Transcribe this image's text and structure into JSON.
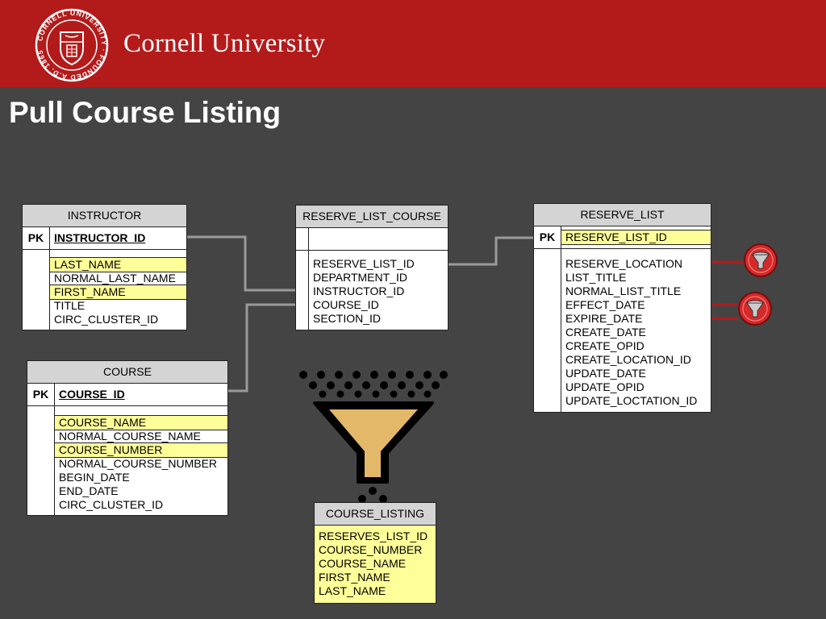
{
  "header": {
    "brand": "Cornell University",
    "seal_text": "CORNELL UNIVERSITY · FOUNDED A.D. 1865"
  },
  "slide": {
    "title": "Pull Course Listing"
  },
  "colors": {
    "header": "#b31b1b",
    "background": "#444444",
    "highlight": "#ffff99",
    "arrow": "#b31b1b",
    "connector": "#9a9a9a",
    "funnel": "#e3b868"
  },
  "tables": {
    "instructor": {
      "name": "INSTRUCTOR",
      "pk_label": "PK",
      "pk_field": "INSTRUCTOR_ID",
      "fields": [
        {
          "name": "LAST_NAME",
          "highlighted": true
        },
        {
          "name": "NORMAL_LAST_NAME",
          "highlighted": false
        },
        {
          "name": "FIRST_NAME",
          "highlighted": true
        },
        {
          "name": "TITLE",
          "highlighted": false
        },
        {
          "name": "CIRC_CLUSTER_ID",
          "highlighted": false
        }
      ]
    },
    "course": {
      "name": "COURSE",
      "pk_label": "PK",
      "pk_field": "COURSE_ID",
      "fields": [
        {
          "name": "COURSE_NAME",
          "highlighted": true
        },
        {
          "name": "NORMAL_COURSE_NAME",
          "highlighted": false
        },
        {
          "name": "COURSE_NUMBER",
          "highlighted": true
        },
        {
          "name": "NORMAL_COURSE_NUMBER",
          "highlighted": false
        },
        {
          "name": "BEGIN_DATE",
          "highlighted": false
        },
        {
          "name": "END_DATE",
          "highlighted": false
        },
        {
          "name": "CIRC_CLUSTER_ID",
          "highlighted": false
        }
      ]
    },
    "reserve_list_course": {
      "name": "RESERVE_LIST_COURSE",
      "fields": [
        "RESERVE_LIST_ID",
        "DEPARTMENT_ID",
        "INSTRUCTOR_ID",
        "COURSE_ID",
        "SECTION_ID"
      ]
    },
    "reserve_list": {
      "name": "RESERVE_LIST",
      "pk_label": "PK",
      "pk_field": "RESERVE_LIST_ID",
      "fields": [
        {
          "name": "RESERVE_LOCATION",
          "filtered": true
        },
        {
          "name": "LIST_TITLE",
          "filtered": false
        },
        {
          "name": "NORMAL_LIST_TITLE",
          "filtered": false
        },
        {
          "name": "EFFECT_DATE",
          "filtered": true
        },
        {
          "name": "EXPIRE_DATE",
          "filtered": true
        },
        {
          "name": "CREATE_DATE",
          "filtered": false
        },
        {
          "name": "CREATE_OPID",
          "filtered": false
        },
        {
          "name": "CREATE_LOCATION_ID",
          "filtered": false
        },
        {
          "name": "UPDATE_DATE",
          "filtered": false
        },
        {
          "name": "UPDATE_OPID",
          "filtered": false
        },
        {
          "name": "UPDATE_LOCTATION_ID",
          "filtered": false
        }
      ]
    },
    "course_listing": {
      "name": "COURSE_LISTING",
      "fields": [
        "RESERVES_LIST_ID",
        "COURSE_NUMBER",
        "COURSE_NAME",
        "FIRST_NAME",
        "LAST_NAME"
      ]
    }
  },
  "icons": {
    "filter": "funnel-filter-icon",
    "funnel": "funnel-icon",
    "seal": "cornell-seal-icon"
  }
}
